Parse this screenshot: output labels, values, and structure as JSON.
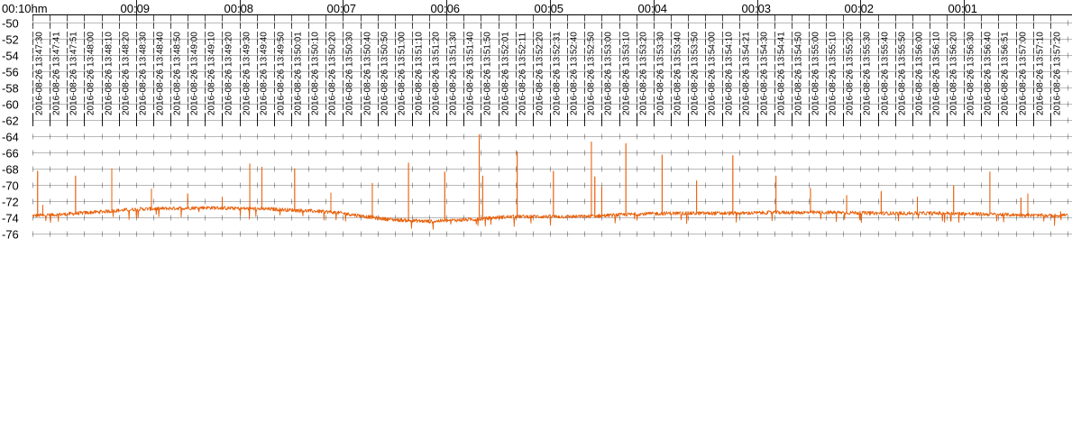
{
  "chart_data": {
    "type": "line",
    "title": "",
    "corner_label": "00:10hm",
    "elapsed_labels": [
      "00:09",
      "00:08",
      "00:07",
      "00:06",
      "00:05",
      "00:04",
      "00:03",
      "00:02",
      "00:01"
    ],
    "timestamp_labels": [
      "2016-08-26 13:47:30",
      "2016-08-26 13:47:41",
      "2016-08-26 13:47:51",
      "2016-08-26 13:48:00",
      "2016-08-26 13:48:10",
      "2016-08-26 13:48:20",
      "2016-08-26 13:48:30",
      "2016-08-26 13:48:40",
      "2016-08-26 13:48:50",
      "2016-08-26 13:49:00",
      "2016-08-26 13:49:10",
      "2016-08-26 13:49:20",
      "2016-08-26 13:49:30",
      "2016-08-26 13:49:40",
      "2016-08-26 13:49:50",
      "2016-08-26 13:50:01",
      "2016-08-26 13:50:10",
      "2016-08-26 13:50:20",
      "2016-08-26 13:50:30",
      "2016-08-26 13:50:40",
      "2016-08-26 13:50:50",
      "2016-08-26 13:51:00",
      "2016-08-26 13:51:10",
      "2016-08-26 13:51:20",
      "2016-08-26 13:51:30",
      "2016-08-26 13:51:40",
      "2016-08-26 13:51:50",
      "2016-08-26 13:52:01",
      "2016-08-26 13:52:11",
      "2016-08-26 13:52:20",
      "2016-08-26 13:52:31",
      "2016-08-26 13:52:40",
      "2016-08-26 13:52:50",
      "2016-08-26 13:53:00",
      "2016-08-26 13:53:10",
      "2016-08-26 13:53:20",
      "2016-08-26 13:53:30",
      "2016-08-26 13:53:40",
      "2016-08-26 13:53:50",
      "2016-08-26 13:54:00",
      "2016-08-26 13:54:10",
      "2016-08-26 13:54:21",
      "2016-08-26 13:54:30",
      "2016-08-26 13:54:41",
      "2016-08-26 13:54:50",
      "2016-08-26 13:55:00",
      "2016-08-26 13:55:10",
      "2016-08-26 13:55:20",
      "2016-08-26 13:55:30",
      "2016-08-26 13:55:40",
      "2016-08-26 13:55:50",
      "2016-08-26 13:56:00",
      "2016-08-26 13:56:10",
      "2016-08-26 13:56:20",
      "2016-08-26 13:56:30",
      "2016-08-26 13:56:40",
      "2016-08-26 13:56:51",
      "2016-08-26 13:57:00",
      "2016-08-26 13:57:10",
      "2016-08-26 13:57:20"
    ],
    "y_ticks": [
      -50,
      -52,
      -54,
      -56,
      -58,
      -60,
      -62,
      -64,
      -66,
      -68,
      -70,
      -72,
      -74,
      -76
    ],
    "y_tick_labels": [
      "-50",
      "-52",
      "-54",
      "-56",
      "-58",
      "-60",
      "-62",
      "-64",
      "-66",
      "-68",
      "-70",
      "-72",
      "-74",
      "-76"
    ],
    "ylim": [
      -76.2,
      -50
    ],
    "xlim": [
      0,
      600
    ],
    "x_unit": "seconds since 2016-08-26 13:47:30",
    "grid": true,
    "series": [
      {
        "color": "#e8600a",
        "baseline": [
          [
            0,
            -73.8
          ],
          [
            20,
            -73.6
          ],
          [
            40,
            -73.3
          ],
          [
            60,
            -73.0
          ],
          [
            80,
            -72.9
          ],
          [
            100,
            -72.8
          ],
          [
            120,
            -72.9
          ],
          [
            140,
            -73.0
          ],
          [
            150,
            -73.1
          ],
          [
            160,
            -73.2
          ],
          [
            170,
            -73.3
          ],
          [
            180,
            -73.5
          ],
          [
            190,
            -73.8
          ],
          [
            200,
            -74.1
          ],
          [
            210,
            -74.3
          ],
          [
            220,
            -74.4
          ],
          [
            230,
            -74.5
          ],
          [
            240,
            -74.4
          ],
          [
            250,
            -74.3
          ],
          [
            260,
            -74.2
          ],
          [
            270,
            -74.0
          ],
          [
            280,
            -73.9
          ],
          [
            300,
            -73.9
          ],
          [
            320,
            -73.9
          ],
          [
            340,
            -73.7
          ],
          [
            350,
            -73.6
          ],
          [
            370,
            -73.5
          ],
          [
            390,
            -73.5
          ],
          [
            410,
            -73.5
          ],
          [
            430,
            -73.4
          ],
          [
            450,
            -73.4
          ],
          [
            470,
            -73.4
          ],
          [
            490,
            -73.5
          ],
          [
            510,
            -73.5
          ],
          [
            530,
            -73.5
          ],
          [
            550,
            -73.6
          ],
          [
            570,
            -73.7
          ],
          [
            590,
            -73.8
          ],
          [
            600,
            -73.7
          ]
        ],
        "spikes": [
          [
            3,
            -68.3
          ],
          [
            6,
            -72.5
          ],
          [
            25,
            -68.9
          ],
          [
            46,
            -68.0
          ],
          [
            69,
            -70.5
          ],
          [
            90,
            -71.1
          ],
          [
            110,
            -71.5
          ],
          [
            126,
            -67.4
          ],
          [
            133,
            -67.8
          ],
          [
            152,
            -68.0
          ],
          [
            173,
            -71.0
          ],
          [
            197,
            -69.8
          ],
          [
            218,
            -67.3
          ],
          [
            239,
            -68.4
          ],
          [
            259,
            -63.8
          ],
          [
            261,
            -68.9
          ],
          [
            281,
            -65.9
          ],
          [
            302,
            -68.3
          ],
          [
            324,
            -64.7
          ],
          [
            326,
            -69.0
          ],
          [
            330,
            -70.2
          ],
          [
            344,
            -64.9
          ],
          [
            365,
            -66.3
          ],
          [
            385,
            -69.5
          ],
          [
            406,
            -66.4
          ],
          [
            431,
            -68.9
          ],
          [
            451,
            -70.4
          ],
          [
            472,
            -71.3
          ],
          [
            492,
            -70.8
          ],
          [
            513,
            -71.5
          ],
          [
            534,
            -70.1
          ],
          [
            555,
            -68.4
          ],
          [
            573,
            -71.6
          ],
          [
            577,
            -71.1
          ],
          [
            596,
            -73.3
          ]
        ]
      }
    ]
  }
}
